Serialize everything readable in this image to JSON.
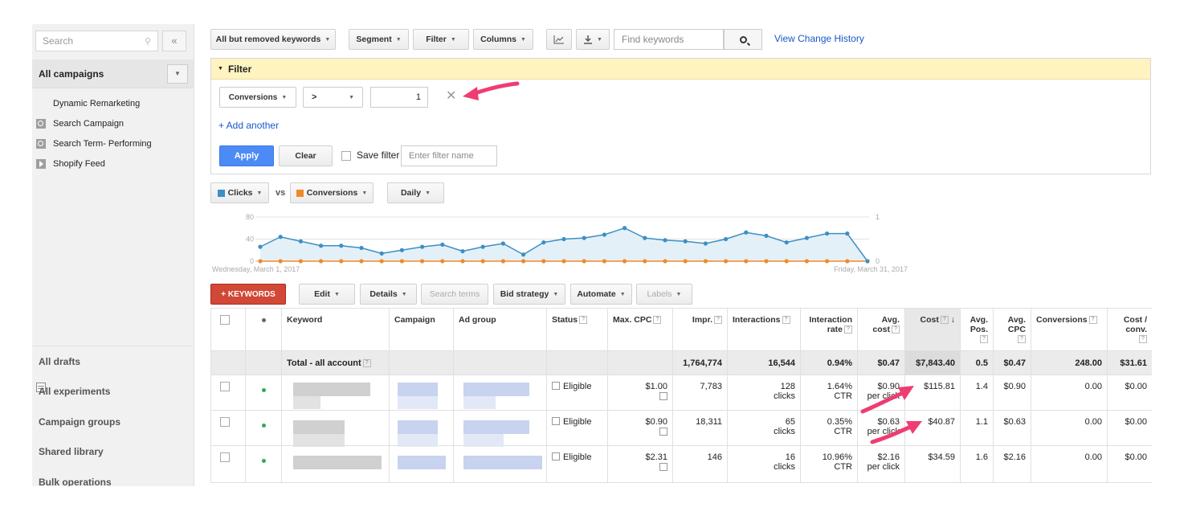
{
  "sidebar": {
    "search_placeholder": "Search",
    "collapse": "«",
    "all_campaigns": "All campaigns",
    "campaigns": [
      {
        "name": "Dynamic Remarketing",
        "icon": "table-icon"
      },
      {
        "name": "Search Campaign",
        "icon": "search-icon"
      },
      {
        "name": "Search Term- Performing",
        "icon": "search-icon"
      },
      {
        "name": "Shopify Feed",
        "icon": "play-icon"
      }
    ],
    "bottom": [
      "All drafts",
      "All experiments",
      "Campaign groups",
      "Shared library",
      "Bulk operations"
    ]
  },
  "toolbar": {
    "view": "All but removed keywords",
    "segment": "Segment",
    "filter": "Filter",
    "columns": "Columns",
    "search_placeholder": "Find keywords",
    "change_history": "View Change History"
  },
  "filter": {
    "title": "Filter",
    "metric": "Conversions",
    "operator": ">",
    "value": "1",
    "add_another": "+ Add another",
    "apply": "Apply",
    "clear": "Clear",
    "save_filter": "Save filter",
    "name_placeholder": "Enter filter name"
  },
  "chart_controls": {
    "metric1": "Clicks",
    "vs": "vs",
    "metric2": "Conversions",
    "period": "Daily"
  },
  "chart_data": {
    "type": "line",
    "x_start_label": "Wednesday, March 1, 2017",
    "x_end_label": "Friday, March 31, 2017",
    "left_ticks": [
      "80",
      "40",
      "0"
    ],
    "right_ticks": [
      "1",
      "0"
    ],
    "ylim_left": [
      0,
      80
    ],
    "ylim_right": [
      0,
      1
    ],
    "series": [
      {
        "name": "Clicks",
        "color": "#3d8fc4",
        "values": [
          26,
          44,
          36,
          28,
          28,
          24,
          14,
          20,
          26,
          30,
          18,
          26,
          32,
          12,
          34,
          40,
          42,
          48,
          60,
          42,
          38,
          36,
          32,
          40,
          52,
          46,
          34,
          42,
          50,
          50,
          0
        ]
      },
      {
        "name": "Conversions",
        "color": "#ef8a2b",
        "values": [
          0,
          0,
          0,
          0,
          0,
          0,
          0,
          0,
          0,
          0,
          0,
          0,
          0,
          0,
          0,
          0,
          0,
          0,
          0,
          0,
          0,
          0,
          0,
          0,
          0,
          0,
          0,
          0,
          0,
          0,
          0
        ]
      }
    ]
  },
  "table_toolbar": {
    "keywords": "+ KEYWORDS",
    "edit": "Edit",
    "details": "Details",
    "search_terms": "Search terms",
    "bid_strategy": "Bid strategy",
    "automate": "Automate",
    "labels": "Labels"
  },
  "table": {
    "headers": {
      "keyword": "Keyword",
      "campaign": "Campaign",
      "ad_group": "Ad group",
      "status": "Status",
      "max_cpc": "Max. CPC",
      "impr": "Impr.",
      "interactions": "Interactions",
      "interaction_rate_1": "Interaction",
      "interaction_rate_2": "rate",
      "avg_cost_1": "Avg.",
      "avg_cost_2": "cost",
      "cost": "Cost",
      "avg_pos_1": "Avg.",
      "avg_pos_2": "Pos.",
      "avg_cpc_1": "Avg.",
      "avg_cpc_2": "CPC",
      "conversions": "Conversions",
      "cost_conv_1": "Cost /",
      "cost_conv_2": "conv.",
      "help": "?"
    },
    "total": {
      "label": "Total - all account",
      "impr": "1,764,774",
      "interactions": "16,544",
      "rate": "0.94%",
      "avg_cost": "$0.47",
      "cost": "$7,843.40",
      "pos": "0.5",
      "cpc": "$0.47",
      "conv": "248.00",
      "cost_conv": "$31.61"
    },
    "rows": [
      {
        "status": "Eligible",
        "max_cpc": "$1.00",
        "impr": "7,783",
        "interactions": "128",
        "int_unit": "clicks",
        "rate": "1.64%",
        "rate_unit": "CTR",
        "avg_cost": "$0.90",
        "avg_cost_unit": "per click",
        "cost": "$115.81",
        "pos": "1.4",
        "cpc": "$0.90",
        "conv": "0.00",
        "cost_conv": "$0.00"
      },
      {
        "status": "Eligible",
        "max_cpc": "$0.90",
        "impr": "18,311",
        "interactions": "65",
        "int_unit": "clicks",
        "rate": "0.35%",
        "rate_unit": "CTR",
        "avg_cost": "$0.63",
        "avg_cost_unit": "per click",
        "cost": "$40.87",
        "pos": "1.1",
        "cpc": "$0.63",
        "conv": "0.00",
        "cost_conv": "$0.00"
      },
      {
        "status": "Eligible",
        "max_cpc": "$2.31",
        "impr": "146",
        "interactions": "16",
        "int_unit": "clicks",
        "rate": "10.96%",
        "rate_unit": "CTR",
        "avg_cost": "$2.16",
        "avg_cost_unit": "per click",
        "cost": "$34.59",
        "pos": "1.6",
        "cpc": "$2.16",
        "conv": "0.00",
        "cost_conv": "$0.00"
      }
    ]
  },
  "colors": {
    "accent": "#1a57c9",
    "apply": "#4c8bf5",
    "keywords_button": "#d14836",
    "arrow": "#ee3d72",
    "filter_bar": "#fff3c0"
  }
}
